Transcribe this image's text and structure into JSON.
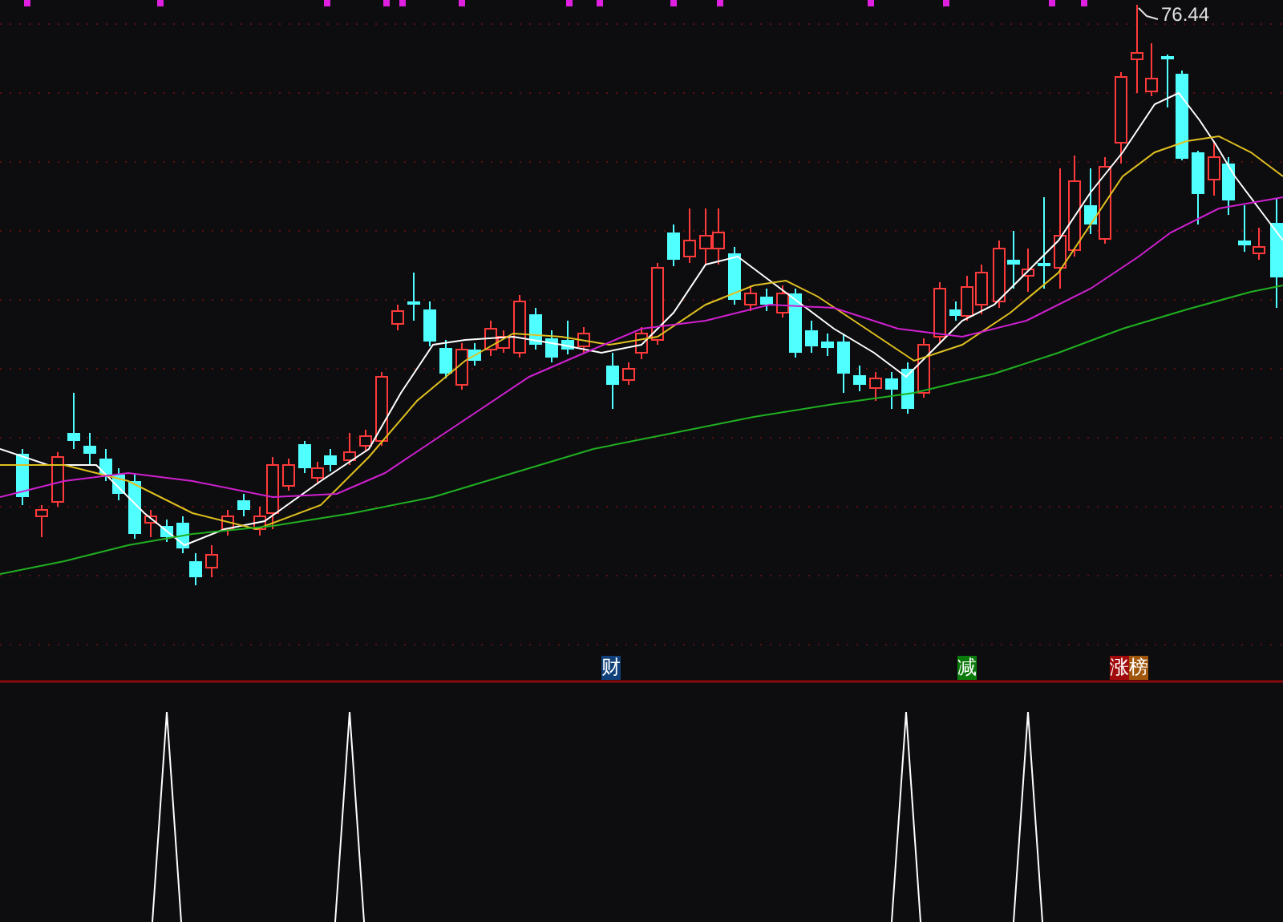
{
  "price_chart": {
    "high_label": "76.44"
  },
  "event_markers": [
    {
      "label": "财",
      "color": "#10407a"
    },
    {
      "label": "减",
      "color": "#0a7a0a"
    },
    {
      "label": "涨",
      "color": "#a00a0a"
    },
    {
      "label": "榜",
      "color": "#a0560a"
    }
  ]
}
